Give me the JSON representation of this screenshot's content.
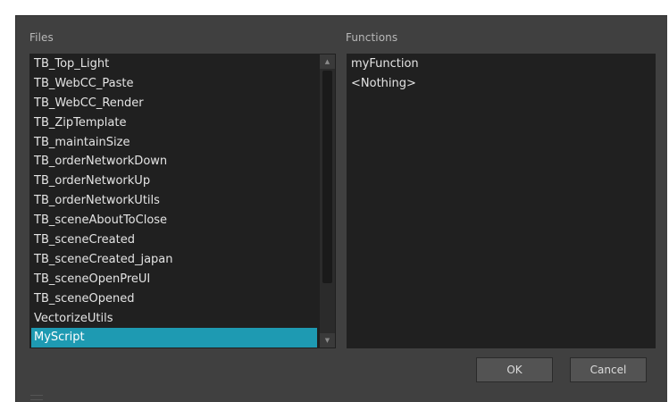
{
  "dialog": {
    "files_label": "Files",
    "functions_label": "Functions",
    "files": [
      "TB_Top_Light",
      "TB_WebCC_Paste",
      "TB_WebCC_Render",
      "TB_ZipTemplate",
      "TB_maintainSize",
      "TB_orderNetworkDown",
      "TB_orderNetworkUp",
      "TB_orderNetworkUtils",
      "TB_sceneAboutToClose",
      "TB_sceneCreated",
      "TB_sceneCreated_japan",
      "TB_sceneOpenPreUI",
      "TB_sceneOpened",
      "VectorizeUtils",
      "MyScript"
    ],
    "selected_file": "MyScript",
    "functions": [
      "myFunction",
      "<Nothing>"
    ],
    "ok_label": "OK",
    "cancel_label": "Cancel"
  },
  "icons": {
    "scroll_up": "scroll-up-arrow-icon",
    "scroll_down": "scroll-down-arrow-icon"
  },
  "colors": {
    "dialog_bg": "#404040",
    "list_bg": "#202020",
    "selection": "#1e9ab2",
    "text": "#e4e4e4"
  }
}
